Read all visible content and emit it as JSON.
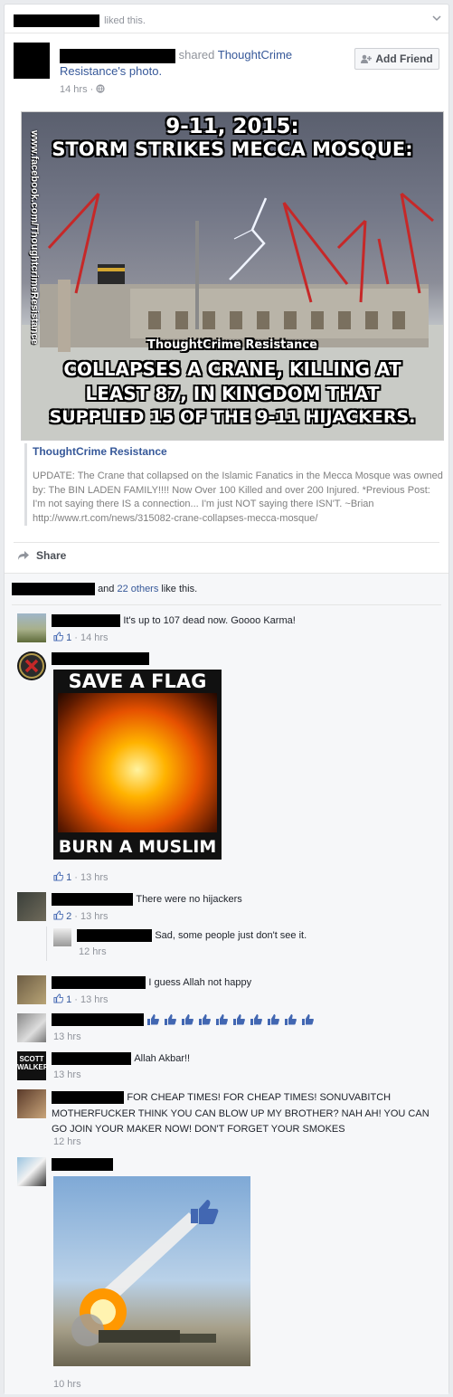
{
  "header": {
    "liked_text": "liked this."
  },
  "post": {
    "shared_text": "shared ",
    "page_link": "ThoughtCrime Resistance",
    "photo_text": "'s photo.",
    "timestamp": "14 hrs",
    "add_friend_label": "Add Friend",
    "image_text": {
      "line1": "9-11, 2015:",
      "line2": "STORM STRIKES MECCA MOSQUE:",
      "watermark": "ThoughtCrime Resistance",
      "bottom1": "COLLAPSES A CRANE, KILLING AT",
      "bottom2": "LEAST 87, IN KINGDOM THAT",
      "bottom3": "SUPPLIED 15 OF THE 9-11 HIJACKERS.",
      "side_url": "www.facebook.com/ThoughtcrimeResistance"
    },
    "quote_source": "ThoughtCrime Resistance",
    "quote_body": "UPDATE: The Crane that collapsed on the Islamic Fanatics in the Mecca Mosque was owned by: The BIN LADEN FAMILY!!!! Now Over 100 Killed and over 200 Injured. *Previous Post: I'm not saying there IS a connection... I'm just NOT saying there ISN'T. ~Brian http://www.rt.com/news/315082-crane-collapses-mecca-mosque/",
    "share_label": "Share"
  },
  "likes": {
    "and": "and ",
    "others": "22 others",
    "suffix": " like this."
  },
  "comments": [
    {
      "text": "It's up to 107 dead now. Goooo Karma!",
      "likes": "1",
      "time": "14 hrs"
    },
    {
      "image_top": "SAVE A FLAG",
      "image_bottom": "BURN A MUSLIM",
      "likes": "1",
      "time": "13 hrs"
    },
    {
      "text": "There were no hijackers",
      "likes": "2",
      "time": "13 hrs"
    },
    {
      "text": "Sad, some people just don't see it.",
      "time": "12 hrs"
    },
    {
      "text": "I guess Allah not happy",
      "likes": "1",
      "time": "13 hrs"
    },
    {
      "time": "13 hrs"
    },
    {
      "avatar_text": "SCOTT WALKER",
      "text": "Allah Akbar!!",
      "time": "13 hrs"
    },
    {
      "text": "FOR CHEAP TIMES! FOR CHEAP TIMES! SONUVABITCH MOTHERFUCKER THINK YOU CAN BLOW UP MY BROTHER? NAH AH! YOU CAN GO JOIN YOUR MAKER NOW! DON'T FORGET YOUR SMOKES",
      "time": "12 hrs"
    },
    {
      "time": "10 hrs"
    }
  ],
  "colors": {
    "link": "#365899",
    "meta": "#90949c",
    "like_blue": "#4267b2"
  }
}
